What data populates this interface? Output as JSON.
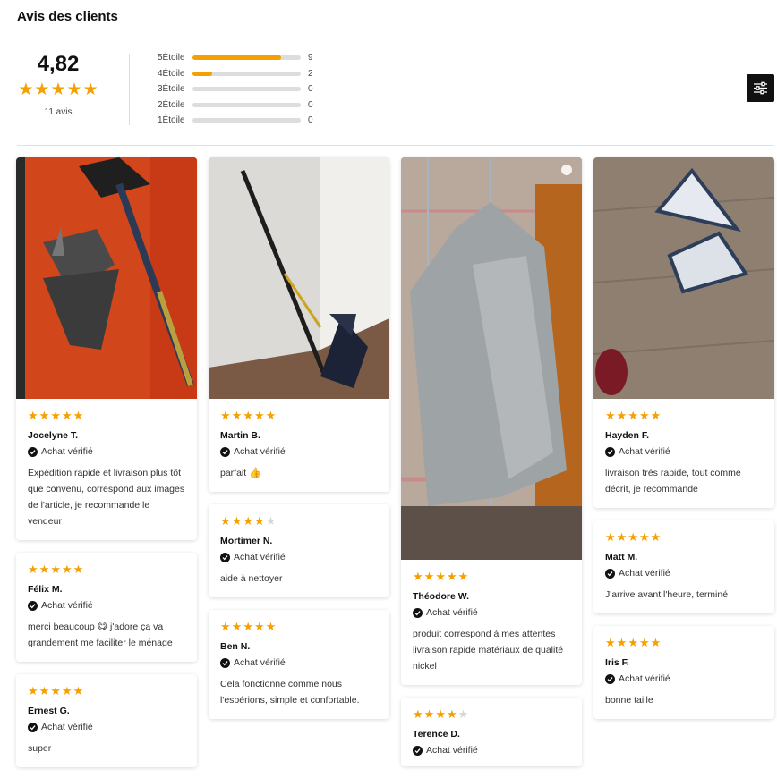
{
  "header": {
    "title": "Avis des clients"
  },
  "summary": {
    "average": "4,82",
    "count_label": "11 avis",
    "rating": 4.82
  },
  "distribution": [
    {
      "label": "5Étoile",
      "count": "9",
      "fraction": 0.82
    },
    {
      "label": "4Étoile",
      "count": "2",
      "fraction": 0.18
    },
    {
      "label": "3Étoile",
      "count": "0",
      "fraction": 0
    },
    {
      "label": "2Étoile",
      "count": "0",
      "fraction": 0
    },
    {
      "label": "1Étoile",
      "count": "0",
      "fraction": 0
    }
  ],
  "filter": {
    "icon": "sliders-icon"
  },
  "colors": {
    "star": "#f5a000",
    "star_off": "#d6d6d6",
    "button": "#111111"
  },
  "verified_label": "Achat vérifié",
  "reviews": [
    {
      "name": "Jocelyne T.",
      "rating": 5,
      "text": "Expédition rapide et livraison plus tôt que convenu, correspond aux images de l'article, je recommande le vendeur"
    },
    {
      "name": "Félix M.",
      "rating": 5,
      "text": "merci beaucoup",
      "emoji": "😋",
      "text_after": "j'adore ça va grandement me faciliter le ménage"
    },
    {
      "name": "Ernest G.",
      "rating": 5,
      "text": "super"
    },
    {
      "name": "Martin B.",
      "rating": 5,
      "text": "parfait",
      "emoji": "👍"
    },
    {
      "name": "Mortimer N.",
      "rating": 4,
      "text": "aide à nettoyer"
    },
    {
      "name": "Ben N.",
      "rating": 5,
      "text": "Cela fonctionne comme nous l'espérions, simple et confortable."
    },
    {
      "name": "Théodore W.",
      "rating": 5,
      "text": "produit correspond à mes attentes livraison rapide matériaux de qualité nickel"
    },
    {
      "name": "Terence D.",
      "rating": 4,
      "text": ""
    },
    {
      "name": "Hayden F.",
      "rating": 5,
      "text": "livraison très rapide, tout comme décrit, je recommande"
    },
    {
      "name": "Matt M.",
      "rating": 5,
      "text": "J'arrive avant l'heure, terminé"
    },
    {
      "name": "Iris F.",
      "rating": 5,
      "text": "bonne taille"
    }
  ]
}
